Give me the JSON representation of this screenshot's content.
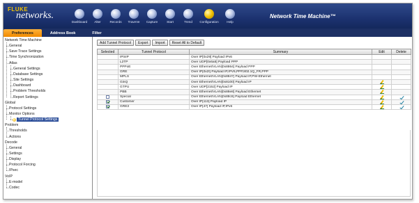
{
  "brand": {
    "name_top": "FLUKE",
    "name_bottom": "networks."
  },
  "toolbar": {
    "items": [
      {
        "label": "Dashboard",
        "icon": "dashboard-icon"
      },
      {
        "label": "Alter",
        "icon": "alter-icon"
      },
      {
        "label": "Records",
        "icon": "records-icon"
      },
      {
        "label": "TraveVe",
        "icon": "traveve-icon"
      },
      {
        "label": "Capture",
        "icon": "capture-icon"
      },
      {
        "label": "Start",
        "icon": "start-icon"
      },
      {
        "label": "Trend",
        "icon": "trend-icon"
      },
      {
        "label": "Configuration",
        "icon": "configuration-icon"
      },
      {
        "label": "Help",
        "icon": "help-icon"
      }
    ],
    "app_title": "Network Time Machine™"
  },
  "tabs": [
    {
      "label": "Preferences",
      "active": true
    },
    {
      "label": "Address Book",
      "active": false
    },
    {
      "label": "Filter",
      "active": false
    }
  ],
  "tree": [
    {
      "label": "Network Time Machine",
      "level": 0
    },
    {
      "label": "General",
      "level": 1
    },
    {
      "label": "Save Trace Settings",
      "level": 1
    },
    {
      "label": "Time Synchronization",
      "level": 1
    },
    {
      "label": "Atlas",
      "level": 1
    },
    {
      "label": "General Settings",
      "level": 2
    },
    {
      "label": "Database Settings",
      "level": 2
    },
    {
      "label": "Site Settings",
      "level": 2
    },
    {
      "label": "Dashboard",
      "level": 2
    },
    {
      "label": "Problem Thresholds",
      "level": 2
    },
    {
      "label": "Report Settings",
      "level": 2
    },
    {
      "label": "Global",
      "level": 0
    },
    {
      "label": "Protocol Settings",
      "level": 1
    },
    {
      "label": "Monitor Options",
      "level": 1
    },
    {
      "label": "Tunnel Protocol Settings",
      "level": 2,
      "selected": true
    },
    {
      "label": "Problem",
      "level": 0
    },
    {
      "label": "Thresholds",
      "level": 1
    },
    {
      "label": "Actions",
      "level": 1
    },
    {
      "label": "Decode",
      "level": 0
    },
    {
      "label": "General",
      "level": 1
    },
    {
      "label": "Settings",
      "level": 1
    },
    {
      "label": "Display",
      "level": 1
    },
    {
      "label": "Protocol Forcing",
      "level": 1
    },
    {
      "label": "IPsec",
      "level": 1
    },
    {
      "label": "VoIP",
      "level": 0
    },
    {
      "label": "E-model",
      "level": 1
    },
    {
      "label": "Codec",
      "level": 1
    }
  ],
  "buttons": {
    "add": "Add Tunnel Protocol",
    "export": "Export",
    "import": "Import",
    "reset": "Reset All to Default"
  },
  "table": {
    "headers": [
      "Selected",
      "Tunnel Protocol",
      "Summary",
      "Edit",
      "Delete"
    ],
    "rows": [
      {
        "selected": null,
        "protocol": "IPinIP",
        "summary": "Over IP[0x29] Payload IPv6",
        "edit": false,
        "delete": false
      },
      {
        "selected": null,
        "protocol": "L2TP",
        "summary": "Over UDP[0x6a5] Payload PPP",
        "edit": false,
        "delete": false
      },
      {
        "selected": null,
        "protocol": "PPPoE",
        "summary": "Over Ethernet/VLAN[0x8864] Payload PPP",
        "edit": false,
        "delete": false
      },
      {
        "selected": null,
        "protocol": "GRE",
        "summary": "Over IP[0x2f] Payload IP,IPV6,PPP,802.1Q_FR,PPP",
        "edit": false,
        "delete": false
      },
      {
        "selected": null,
        "protocol": "MPLS",
        "summary": "Over Ethernet/VLAN[0x8847] Payload IP,PW-Ethernet",
        "edit": false,
        "delete": false
      },
      {
        "selected": null,
        "protocol": "GinQ",
        "summary": "Over Ethernet/VLAN[0x8100] Payload IP",
        "edit": true,
        "delete": false
      },
      {
        "selected": null,
        "protocol": "GTPU",
        "summary": "Over UDP[2152] Payload IP",
        "edit": true,
        "delete": false
      },
      {
        "selected": null,
        "protocol": "PBB",
        "summary": "Over Ethernet/VLAN[0x88e8] Payload Ethernet",
        "edit": true,
        "delete": false
      },
      {
        "selected": false,
        "protocol": "Special",
        "summary": "Over Ethernet/VLAN[0x88c8] Payload Ethernet",
        "edit": true,
        "delete": true
      },
      {
        "selected": true,
        "protocol": "Customer",
        "summary": "Over IP[113] Payload IP",
        "edit": true,
        "delete": true
      },
      {
        "selected": true,
        "protocol": "GRE3",
        "summary": "Over IP[47] Payload IP,IPv6",
        "edit": true,
        "delete": true
      }
    ]
  },
  "colors": {
    "toolbar_bg": "#1c3270",
    "tab_active": "#f08a00",
    "tree_selected": "#2d4f9a",
    "brand_yellow": "#f3c300"
  }
}
